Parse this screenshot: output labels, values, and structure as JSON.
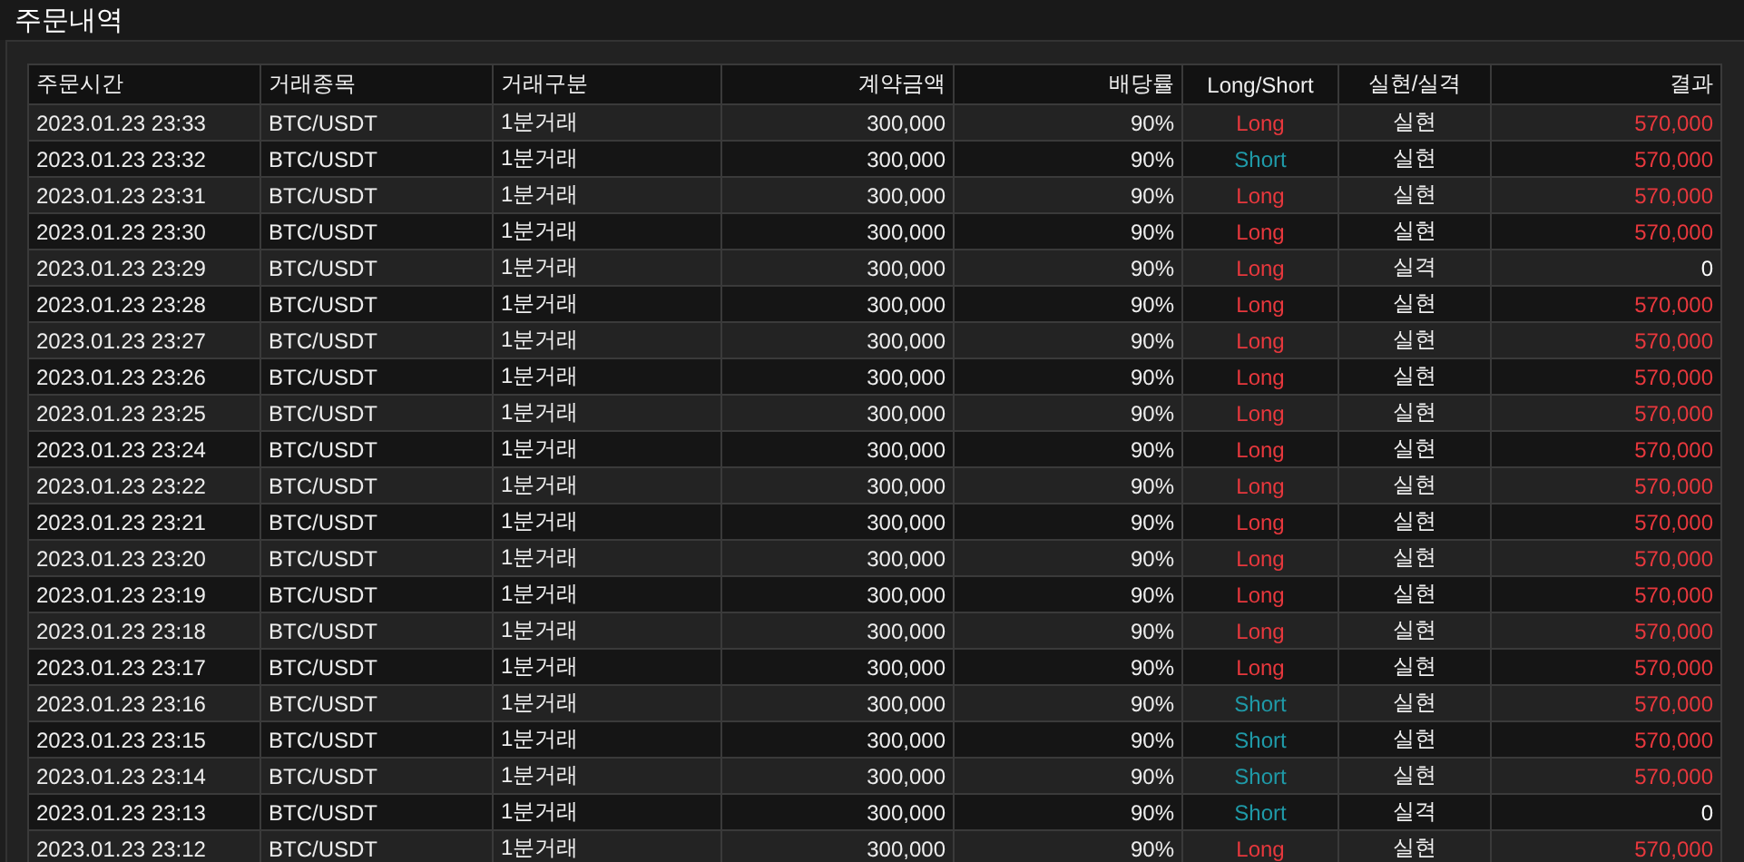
{
  "title": "주문내역",
  "columns": [
    "주문시간",
    "거래종목",
    "거래구분",
    "계약금액",
    "배당률",
    "Long/Short",
    "실현/실격",
    "결과"
  ],
  "rows": [
    {
      "time": "2023.01.23 23:33",
      "symbol": "BTC/USDT",
      "type": "1분거래",
      "amount": "300,000",
      "rate": "90%",
      "kind": "long",
      "side_label": "Long",
      "status": "실현",
      "won": true,
      "result": "570,000"
    },
    {
      "time": "2023.01.23 23:32",
      "symbol": "BTC/USDT",
      "type": "1분거래",
      "amount": "300,000",
      "rate": "90%",
      "kind": "short",
      "side_label": "Short",
      "status": "실현",
      "won": true,
      "result": "570,000"
    },
    {
      "time": "2023.01.23 23:31",
      "symbol": "BTC/USDT",
      "type": "1분거래",
      "amount": "300,000",
      "rate": "90%",
      "kind": "long",
      "side_label": "Long",
      "status": "실현",
      "won": true,
      "result": "570,000"
    },
    {
      "time": "2023.01.23 23:30",
      "symbol": "BTC/USDT",
      "type": "1분거래",
      "amount": "300,000",
      "rate": "90%",
      "kind": "long",
      "side_label": "Long",
      "status": "실현",
      "won": true,
      "result": "570,000"
    },
    {
      "time": "2023.01.23 23:29",
      "symbol": "BTC/USDT",
      "type": "1분거래",
      "amount": "300,000",
      "rate": "90%",
      "kind": "long",
      "side_label": "Long",
      "status": "실격",
      "won": false,
      "result": "0"
    },
    {
      "time": "2023.01.23 23:28",
      "symbol": "BTC/USDT",
      "type": "1분거래",
      "amount": "300,000",
      "rate": "90%",
      "kind": "long",
      "side_label": "Long",
      "status": "실현",
      "won": true,
      "result": "570,000"
    },
    {
      "time": "2023.01.23 23:27",
      "symbol": "BTC/USDT",
      "type": "1분거래",
      "amount": "300,000",
      "rate": "90%",
      "kind": "long",
      "side_label": "Long",
      "status": "실현",
      "won": true,
      "result": "570,000"
    },
    {
      "time": "2023.01.23 23:26",
      "symbol": "BTC/USDT",
      "type": "1분거래",
      "amount": "300,000",
      "rate": "90%",
      "kind": "long",
      "side_label": "Long",
      "status": "실현",
      "won": true,
      "result": "570,000"
    },
    {
      "time": "2023.01.23 23:25",
      "symbol": "BTC/USDT",
      "type": "1분거래",
      "amount": "300,000",
      "rate": "90%",
      "kind": "long",
      "side_label": "Long",
      "status": "실현",
      "won": true,
      "result": "570,000"
    },
    {
      "time": "2023.01.23 23:24",
      "symbol": "BTC/USDT",
      "type": "1분거래",
      "amount": "300,000",
      "rate": "90%",
      "kind": "long",
      "side_label": "Long",
      "status": "실현",
      "won": true,
      "result": "570,000"
    },
    {
      "time": "2023.01.23 23:22",
      "symbol": "BTC/USDT",
      "type": "1분거래",
      "amount": "300,000",
      "rate": "90%",
      "kind": "long",
      "side_label": "Long",
      "status": "실현",
      "won": true,
      "result": "570,000"
    },
    {
      "time": "2023.01.23 23:21",
      "symbol": "BTC/USDT",
      "type": "1분거래",
      "amount": "300,000",
      "rate": "90%",
      "kind": "long",
      "side_label": "Long",
      "status": "실현",
      "won": true,
      "result": "570,000"
    },
    {
      "time": "2023.01.23 23:20",
      "symbol": "BTC/USDT",
      "type": "1분거래",
      "amount": "300,000",
      "rate": "90%",
      "kind": "long",
      "side_label": "Long",
      "status": "실현",
      "won": true,
      "result": "570,000"
    },
    {
      "time": "2023.01.23 23:19",
      "symbol": "BTC/USDT",
      "type": "1분거래",
      "amount": "300,000",
      "rate": "90%",
      "kind": "long",
      "side_label": "Long",
      "status": "실현",
      "won": true,
      "result": "570,000"
    },
    {
      "time": "2023.01.23 23:18",
      "symbol": "BTC/USDT",
      "type": "1분거래",
      "amount": "300,000",
      "rate": "90%",
      "kind": "long",
      "side_label": "Long",
      "status": "실현",
      "won": true,
      "result": "570,000"
    },
    {
      "time": "2023.01.23 23:17",
      "symbol": "BTC/USDT",
      "type": "1분거래",
      "amount": "300,000",
      "rate": "90%",
      "kind": "long",
      "side_label": "Long",
      "status": "실현",
      "won": true,
      "result": "570,000"
    },
    {
      "time": "2023.01.23 23:16",
      "symbol": "BTC/USDT",
      "type": "1분거래",
      "amount": "300,000",
      "rate": "90%",
      "kind": "short",
      "side_label": "Short",
      "status": "실현",
      "won": true,
      "result": "570,000"
    },
    {
      "time": "2023.01.23 23:15",
      "symbol": "BTC/USDT",
      "type": "1분거래",
      "amount": "300,000",
      "rate": "90%",
      "kind": "short",
      "side_label": "Short",
      "status": "실현",
      "won": true,
      "result": "570,000"
    },
    {
      "time": "2023.01.23 23:14",
      "symbol": "BTC/USDT",
      "type": "1분거래",
      "amount": "300,000",
      "rate": "90%",
      "kind": "short",
      "side_label": "Short",
      "status": "실현",
      "won": true,
      "result": "570,000"
    },
    {
      "time": "2023.01.23 23:13",
      "symbol": "BTC/USDT",
      "type": "1분거래",
      "amount": "300,000",
      "rate": "90%",
      "kind": "short",
      "side_label": "Short",
      "status": "실격",
      "won": false,
      "result": "0"
    },
    {
      "time": "2023.01.23 23:12",
      "symbol": "BTC/USDT",
      "type": "1분거래",
      "amount": "300,000",
      "rate": "90%",
      "kind": "long",
      "side_label": "Long",
      "status": "실현",
      "won": true,
      "result": "570,000"
    }
  ]
}
